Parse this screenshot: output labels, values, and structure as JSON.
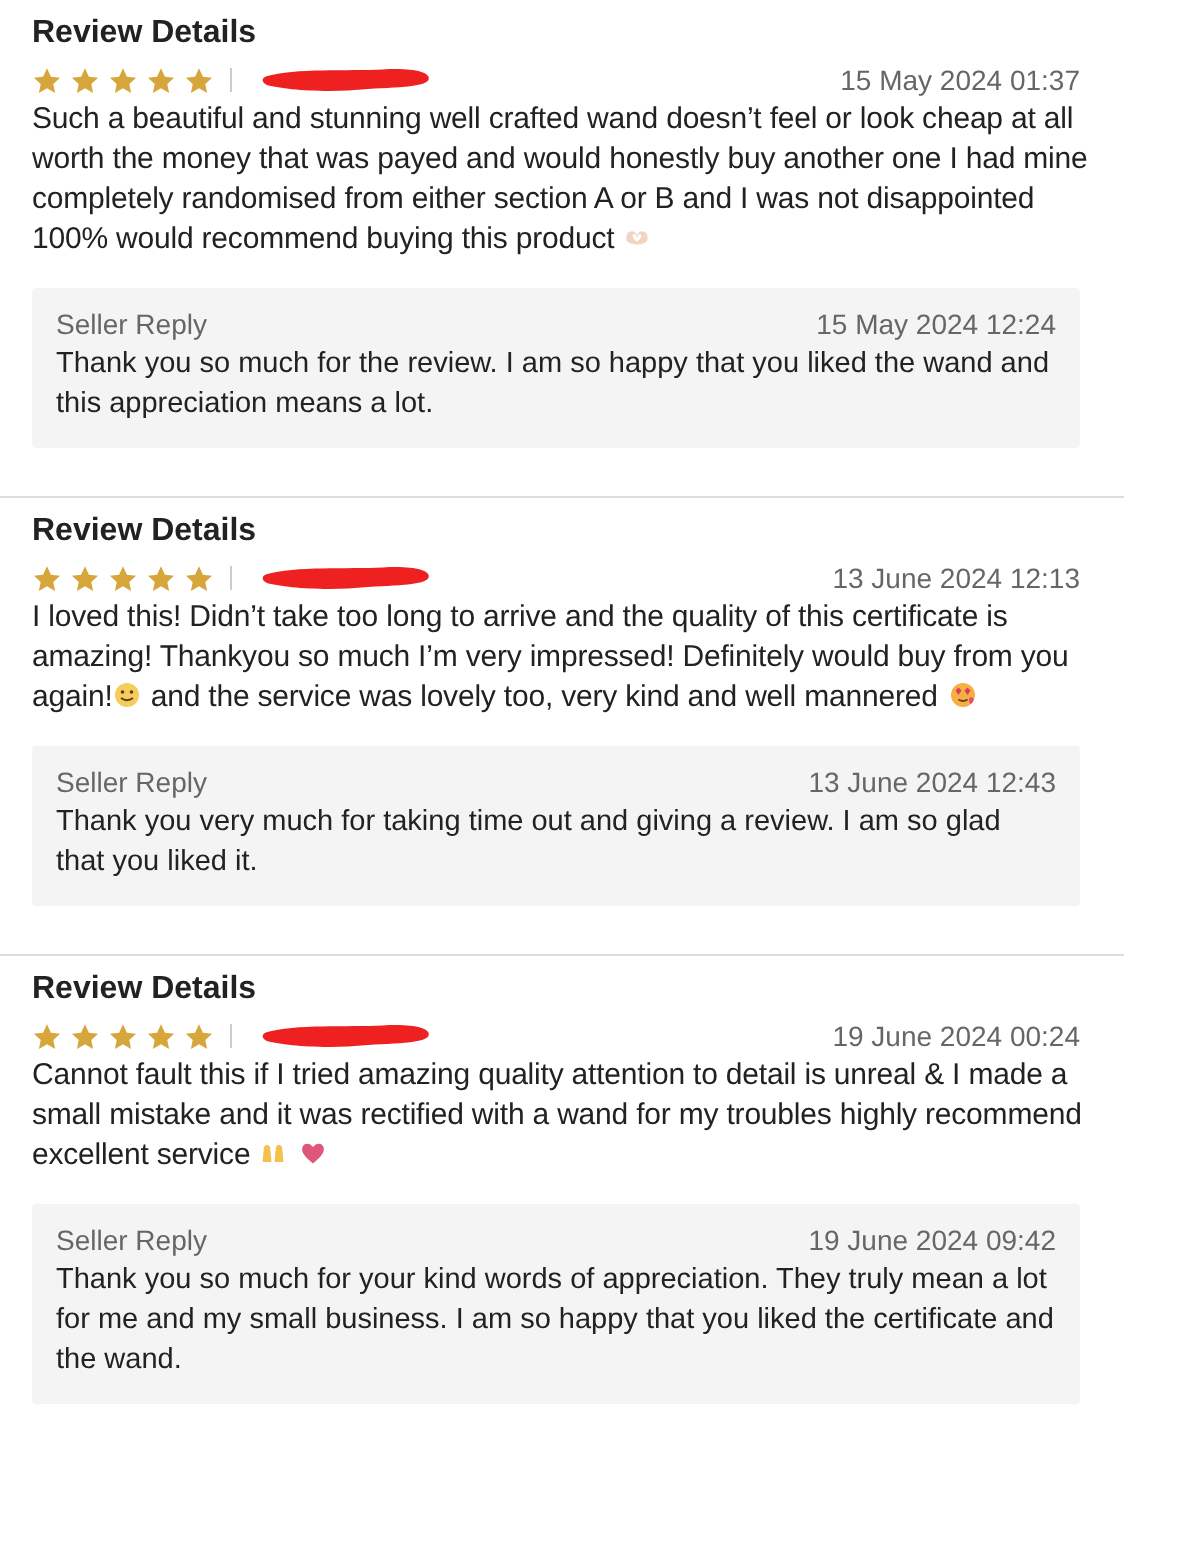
{
  "reviews": [
    {
      "heading": "Review Details",
      "stars": 5,
      "date": "15 May 2024 01:37",
      "body": [
        {
          "kind": "text",
          "text": "Such a beautiful and stunning well crafted wand doesn’t feel or look cheap at all worth the money that was payed and would honestly buy another one I had mine completely randomised from either section A or B and I was not disappointed 100% would recommend buying this product "
        },
        {
          "kind": "icon"
        }
      ],
      "reply": {
        "label": "Seller Reply",
        "date": "15 May 2024 12:24",
        "text": "Thank you so much for the review. I am so happy that you liked the wand and this appreciation means a lot."
      }
    },
    {
      "heading": "Review Details",
      "stars": 5,
      "date": "13 June 2024 12:13",
      "body": [
        {
          "kind": "text",
          "text": "I loved this! Didn’t take too long to arrive and the quality of this certificate is amazing! Thankyou so much I’m very impressed! Definitely would buy from you again!"
        },
        {
          "kind": "icon"
        },
        {
          "kind": "text",
          "text": " and the service was lovely too, very kind and well mannered"
        },
        {
          "kind": "icon"
        }
      ],
      "reply": {
        "label": "Seller Reply",
        "date": "13 June 2024 12:43",
        "text": "Thank you very much for taking time out and giving a review. I am so glad that you liked it."
      }
    },
    {
      "heading": "Review Details",
      "stars": 5,
      "date": "19 June 2024 00:24",
      "body": [
        {
          "kind": "text",
          "text": "Cannot fault this if I tried amazing quality attention to detail is unreal & I made a small mistake and it was rectified with a wand for my troubles highly recommend excellent service "
        },
        {
          "kind": "icon"
        },
        {
          "kind": "icon"
        }
      ],
      "reply": {
        "label": "Seller Reply",
        "date": "19 June 2024 09:42",
        "text": "Thank you so much for your kind words of appreciation. They truly mean a lot for me and my small business. I am so happy that you liked the certificate and the wand."
      }
    }
  ]
}
